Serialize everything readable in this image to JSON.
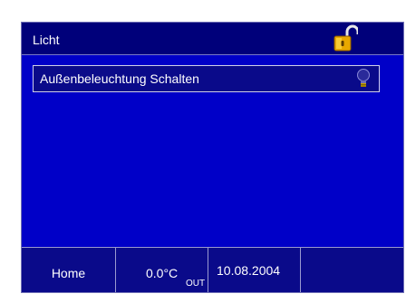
{
  "header": {
    "title": "Licht",
    "icon": "lock-open-icon"
  },
  "items": [
    {
      "label": "Außenbeleuchtung Schalten",
      "icon": "lightbulb-icon"
    }
  ],
  "status": {
    "home_label": "Home",
    "temperature": "0.0°C",
    "temperature_sub": "OUT",
    "date": "10.08.2004"
  },
  "colors": {
    "background": "#0000c8",
    "title_bar": "#00007a",
    "text": "#ffffff",
    "lock_gold": "#e8a800"
  }
}
